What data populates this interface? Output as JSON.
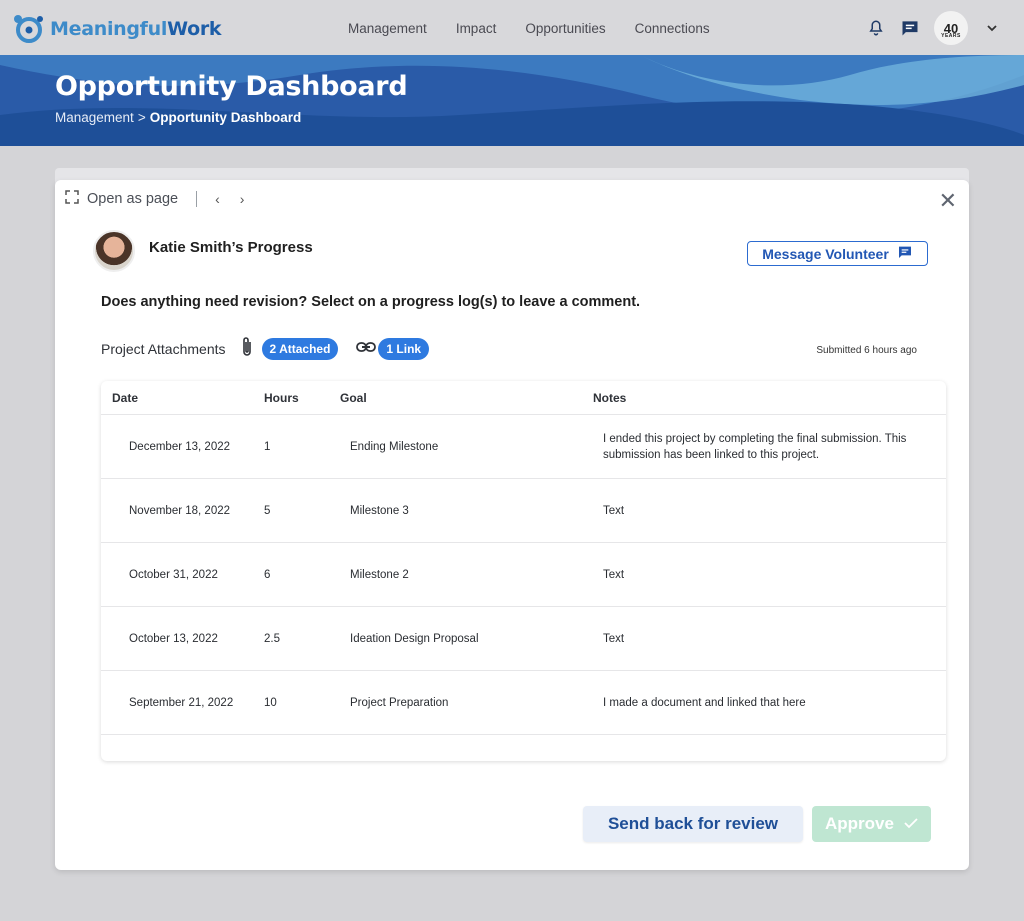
{
  "brand": {
    "name_part1": "Meaningful",
    "name_part2": "Work"
  },
  "nav": {
    "items": [
      "Management",
      "Impact",
      "Opportunities",
      "Connections"
    ]
  },
  "account": {
    "badge_number": "40",
    "badge_text": "YEARS"
  },
  "header": {
    "title": "Opportunity Dashboard",
    "breadcrumb": {
      "parent": "Management",
      "separator": ">",
      "current": "Opportunity Dashboard"
    }
  },
  "modal": {
    "open_as_page": "Open as page",
    "volunteer_name": "Katie Smith’s Progress",
    "message_button": "Message Volunteer",
    "question": "Does anything need revision? Select on a progress log(s) to leave a comment.",
    "attachments_label": "Project Attachments",
    "attached_pill": "2 Attached",
    "link_pill": "1 Link",
    "submitted": "Submitted 6 hours ago",
    "send_back_button": "Send back for review",
    "approve_button": "Approve"
  },
  "table": {
    "columns": [
      "Date",
      "Hours",
      "Goal",
      "Notes"
    ],
    "rows": [
      {
        "date": "December 13, 2022",
        "hours": "1",
        "goal": "Ending Milestone",
        "notes": "I ended this project by completing the final submission. This submission has been linked to this project."
      },
      {
        "date": "November 18, 2022",
        "hours": "5",
        "goal": "Milestone 3",
        "notes": "Text"
      },
      {
        "date": "October 31, 2022",
        "hours": "6",
        "goal": "Milestone 2",
        "notes": "Text"
      },
      {
        "date": "October 13, 2022",
        "hours": "2.5",
        "goal": "Ideation Design Proposal",
        "notes": "Text"
      },
      {
        "date": "September 21, 2022",
        "hours": "10",
        "goal": "Project Preparation",
        "notes": "I made a document and linked that here"
      }
    ]
  },
  "colors": {
    "banner": "#2a5ba8",
    "accent": "#2e7ae0",
    "approve_disabled": "#bfe6d2"
  }
}
